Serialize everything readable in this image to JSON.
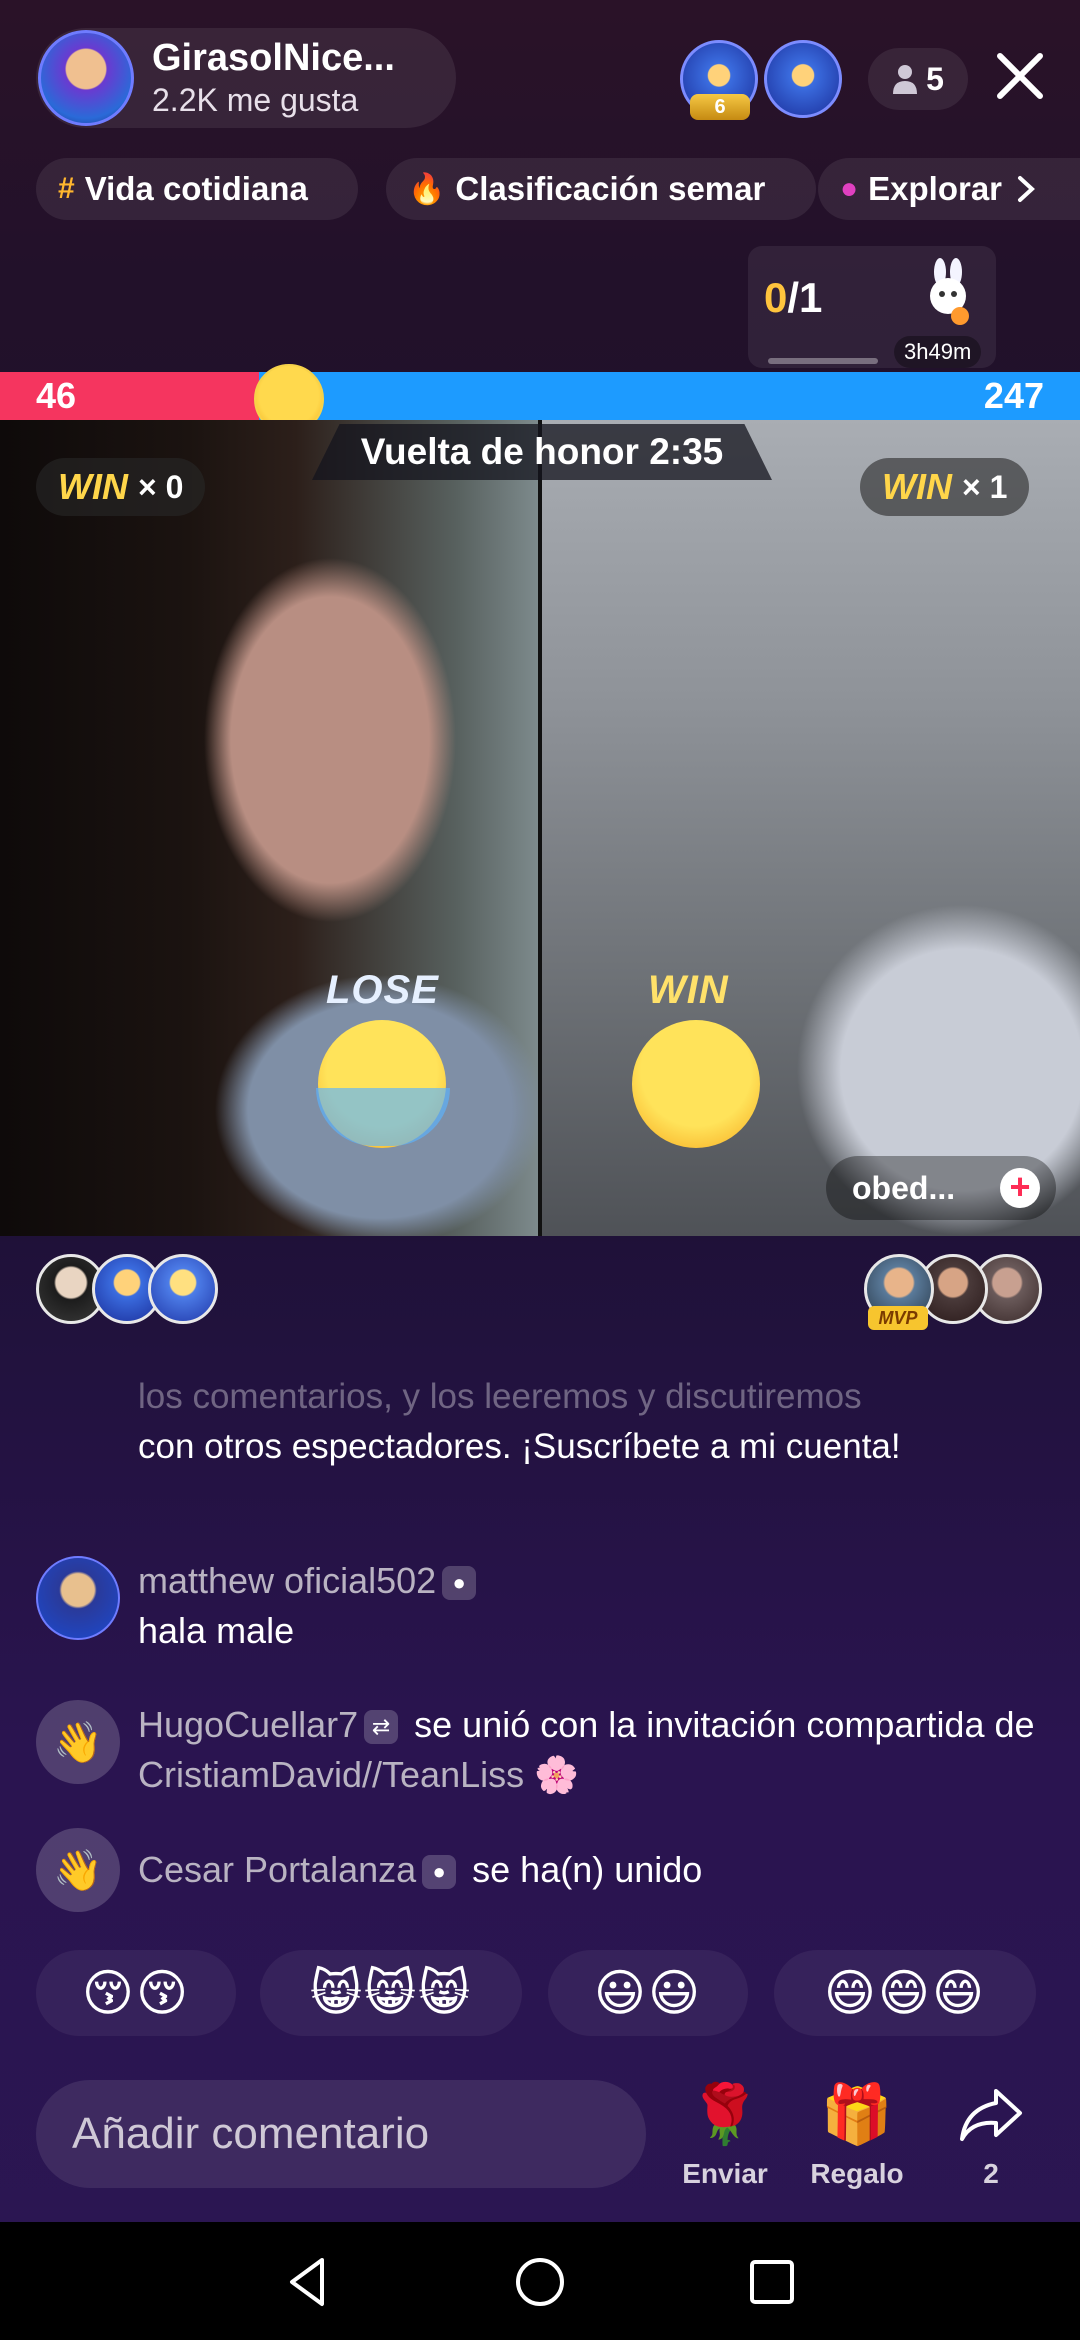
{
  "header": {
    "host_name": "GirasolNice...",
    "likes": "2.2K me gusta",
    "top_viewer_rank": "6",
    "viewer_count": "5"
  },
  "chips": [
    {
      "label": "Vida cotidiana",
      "icon": "hashtag-icon"
    },
    {
      "label": "Clasificación semar",
      "icon": "flame-icon"
    },
    {
      "label": "Explorar",
      "icon": "planet-icon"
    }
  ],
  "goal": {
    "current": "0",
    "total": "/1",
    "timer": "3h49m"
  },
  "battle": {
    "score_left": 46,
    "score_right": 247,
    "honor_lap": "Vuelta de honor 2:35",
    "win_word": "WIN",
    "left_wins": "× 0",
    "right_wins": "× 1",
    "left_result": "LOSE",
    "right_result": "WIN",
    "opponent_name": "obed...",
    "follow_symbol": "+"
  },
  "mvp_label": "MVP",
  "chat": {
    "faded_line": "los comentarios, y los leeremos y discutiremos",
    "faded_text": "con otros espectadores. ¡Suscríbete a mi cuenta!",
    "messages": [
      {
        "user": "matthew oficial502",
        "text": "hala male"
      },
      {
        "user": "HugoCuellar7",
        "text": "se unió con la invitación compartida de",
        "inviter": "CristiamDavid//TeanLiss",
        "inviter_emoji": "🌸"
      },
      {
        "user": "Cesar Portalanza",
        "text": "se ha(n) unido"
      }
    ]
  },
  "quick_emojis": [
    "😚😚",
    "😸😸😸",
    "😃😃",
    "😄😄😄"
  ],
  "bottom": {
    "comment_placeholder": "Añadir comentario",
    "send_label": "Enviar",
    "gift_label": "Regalo",
    "share_count": "2"
  },
  "colors": {
    "red_team": "#f5355f",
    "blue_team": "#1d9bff",
    "win_gold": "#ffd64a",
    "goal_gold": "#ffc43d"
  }
}
